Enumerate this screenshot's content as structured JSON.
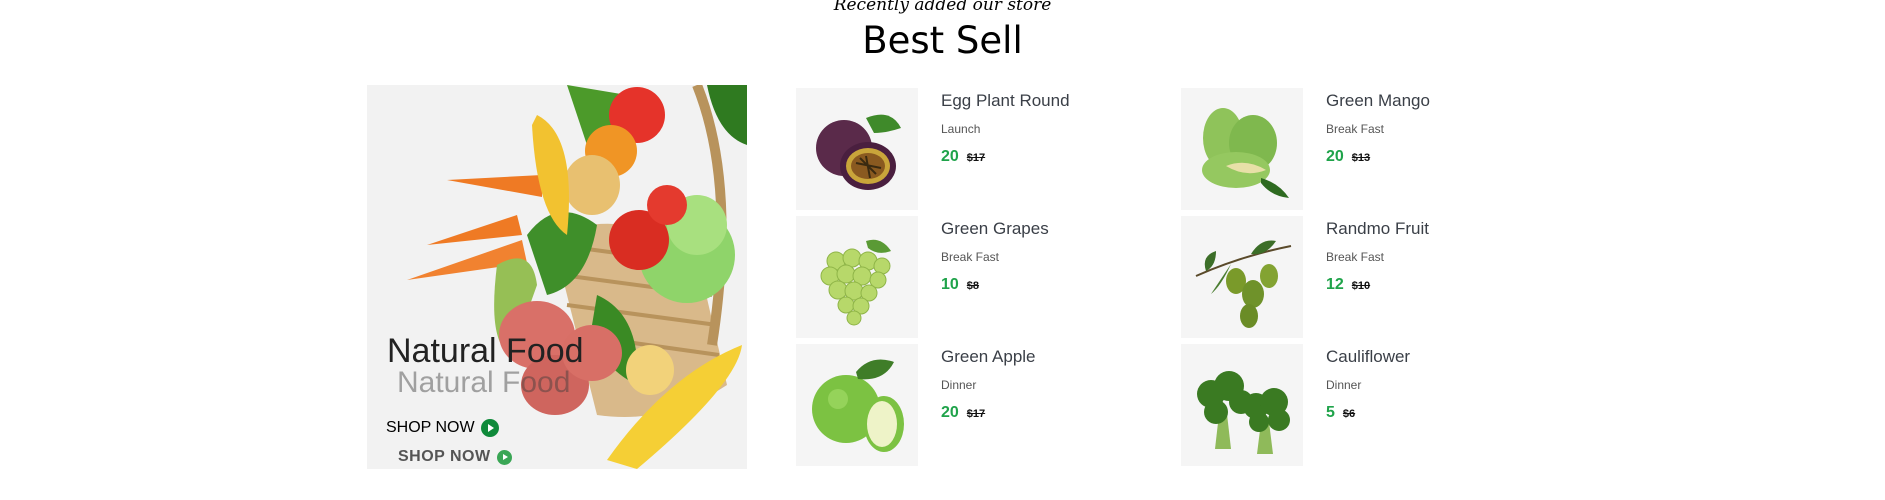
{
  "section": {
    "subtitle": "Recently added our store",
    "title": "Best Sell"
  },
  "banner": {
    "title": "Natural Food",
    "cta": "SHOP NOW",
    "ghost_title": "Natural Food",
    "ghost_cta": "SHOP NOW"
  },
  "products": [
    {
      "name": "Egg Plant Round",
      "category": "Launch",
      "price": "20",
      "old_price": "$17",
      "image": "passion-fruit"
    },
    {
      "name": "Green Mango",
      "category": "Break Fast",
      "price": "20",
      "old_price": "$13",
      "image": "green-mango"
    },
    {
      "name": "Green Grapes",
      "category": "Break Fast",
      "price": "10",
      "old_price": "$8",
      "image": "green-grapes"
    },
    {
      "name": "Randmo Fruit",
      "category": "Break Fast",
      "price": "12",
      "old_price": "$10",
      "image": "olives"
    },
    {
      "name": "Green Apple",
      "category": "Dinner",
      "price": "20",
      "old_price": "$17",
      "image": "green-apple"
    },
    {
      "name": "Cauliflower",
      "category": "Dinner",
      "price": "5",
      "old_price": "$6",
      "image": "broccoli"
    }
  ],
  "colors": {
    "price_green": "#1fa34a",
    "button_green": "#0f8a3a"
  }
}
